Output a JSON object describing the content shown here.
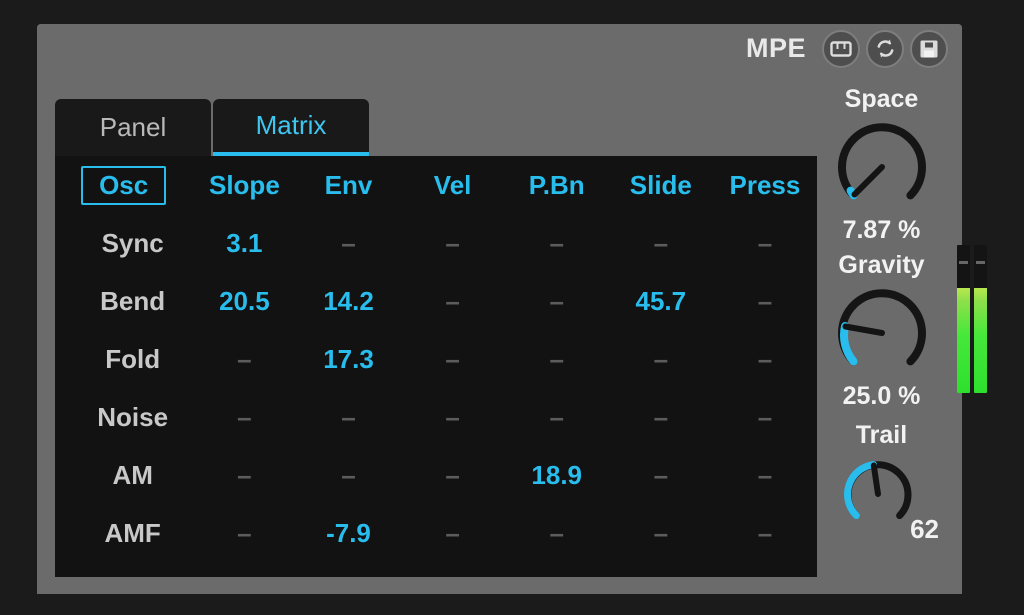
{
  "window": {
    "header": {
      "mpe_label": "MPE",
      "buttons": [
        {
          "name": "mpe-keyboard-icon",
          "icon": "keyboard-icon"
        },
        {
          "name": "refresh-icon",
          "icon": "refresh-icon"
        },
        {
          "name": "save-icon",
          "icon": "floppy-disk-icon"
        }
      ]
    },
    "tabs": [
      {
        "label": "Panel",
        "active": false
      },
      {
        "label": "Matrix",
        "active": true
      }
    ]
  },
  "matrix": {
    "columns": [
      "Osc",
      "Slope",
      "Env",
      "Vel",
      "P.Bn",
      "Slide",
      "Press"
    ],
    "selected_column": "Osc",
    "empty_marker": "–",
    "rows": [
      {
        "label": "Sync",
        "values": [
          "3.1",
          "–",
          "–",
          "–",
          "–",
          "–"
        ]
      },
      {
        "label": "Bend",
        "values": [
          "20.5",
          "14.2",
          "–",
          "–",
          "45.7",
          "–"
        ]
      },
      {
        "label": "Fold",
        "values": [
          "–",
          "17.3",
          "–",
          "–",
          "–",
          "–"
        ]
      },
      {
        "label": "Noise",
        "values": [
          "–",
          "–",
          "–",
          "–",
          "–",
          "–"
        ]
      },
      {
        "label": "AM",
        "values": [
          "–",
          "–",
          "–",
          "18.9",
          "–",
          "–"
        ]
      },
      {
        "label": "AMF",
        "values": [
          "–",
          "-7.9",
          "–",
          "–",
          "–",
          "–"
        ]
      }
    ]
  },
  "knobs": [
    {
      "title": "Space",
      "value": "7.87 %",
      "percent": 7.87
    },
    {
      "title": "Gravity",
      "value": "25.0 %",
      "percent": 25.0
    },
    {
      "title": "Trail",
      "value": "62",
      "percent": 62
    }
  ],
  "meters": {
    "levels": [
      71,
      71
    ]
  },
  "colors": {
    "accent": "#29bdee",
    "panel_bg": "#121212",
    "chrome": "#6b6b6b",
    "text_dim": "#c8c8c8",
    "meter_green": "#3ce03c"
  }
}
